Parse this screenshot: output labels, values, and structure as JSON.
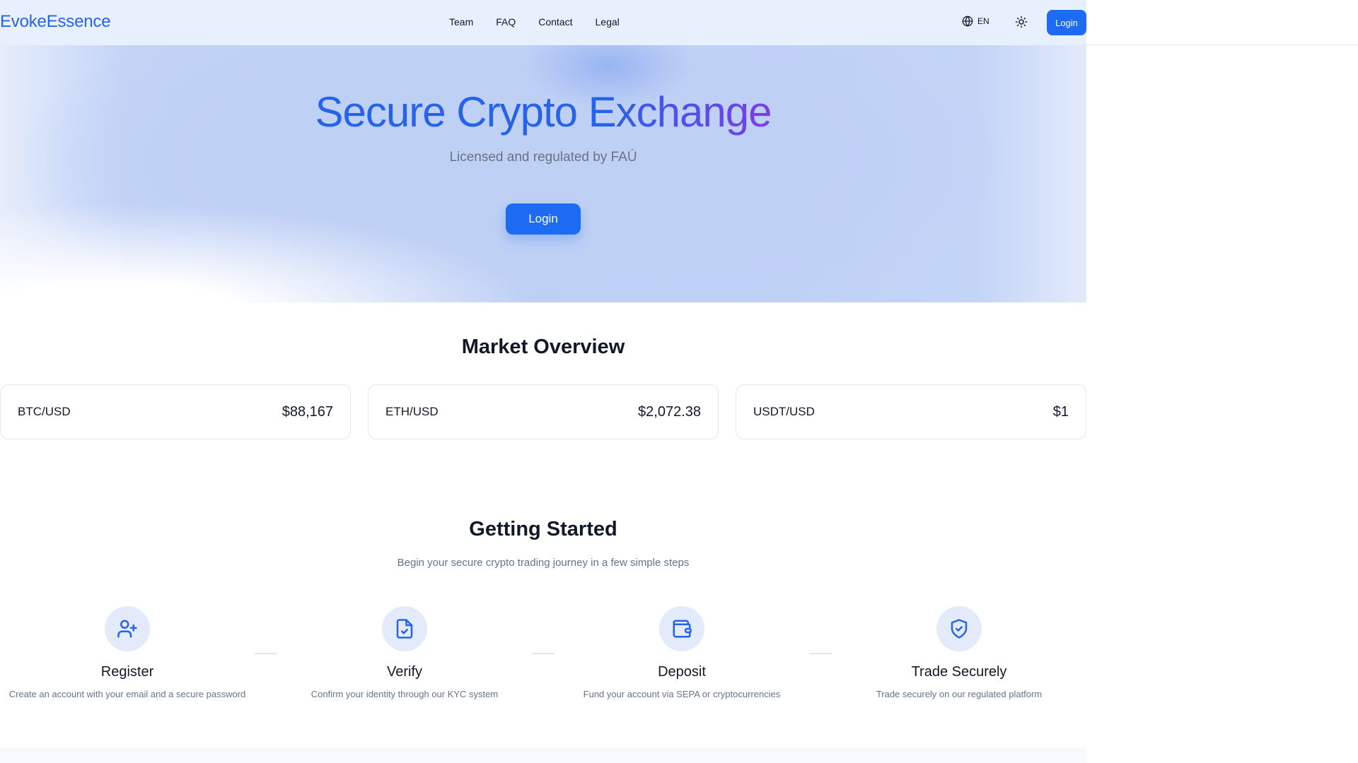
{
  "brand": {
    "name": "EvokeEssence",
    "accent": "#2563eb",
    "button_color": "#1d6bf2",
    "gradient_end": "#9333ea"
  },
  "header": {
    "nav": [
      "Team",
      "FAQ",
      "Contact",
      "Legal"
    ],
    "language": {
      "icon": "globe-icon",
      "code": "EN"
    },
    "theme_icon": "sun-icon",
    "login_label": "Login"
  },
  "hero": {
    "title": "Secure Crypto Exchange",
    "subtitle": "Licensed and regulated by FAÚ",
    "login_label": "Login"
  },
  "market": {
    "title": "Market Overview",
    "items": [
      {
        "pair": "BTC/USD",
        "price": "$88,167"
      },
      {
        "pair": "ETH/USD",
        "price": "$2,072.38"
      },
      {
        "pair": "USDT/USD",
        "price": "$1"
      }
    ]
  },
  "getting_started": {
    "title": "Getting Started",
    "subtitle": "Begin your secure crypto trading journey in a few simple steps",
    "steps": [
      {
        "icon": "user-plus-icon",
        "title": "Register",
        "desc": "Create an account with your email and a secure password"
      },
      {
        "icon": "file-check-icon",
        "title": "Verify",
        "desc": "Confirm your identity through our KYC system"
      },
      {
        "icon": "wallet-icon",
        "title": "Deposit",
        "desc": "Fund your account via SEPA or cryptocurrencies"
      },
      {
        "icon": "shield-check-icon",
        "title": "Trade Securely",
        "desc": "Trade securely on our regulated platform"
      }
    ]
  }
}
